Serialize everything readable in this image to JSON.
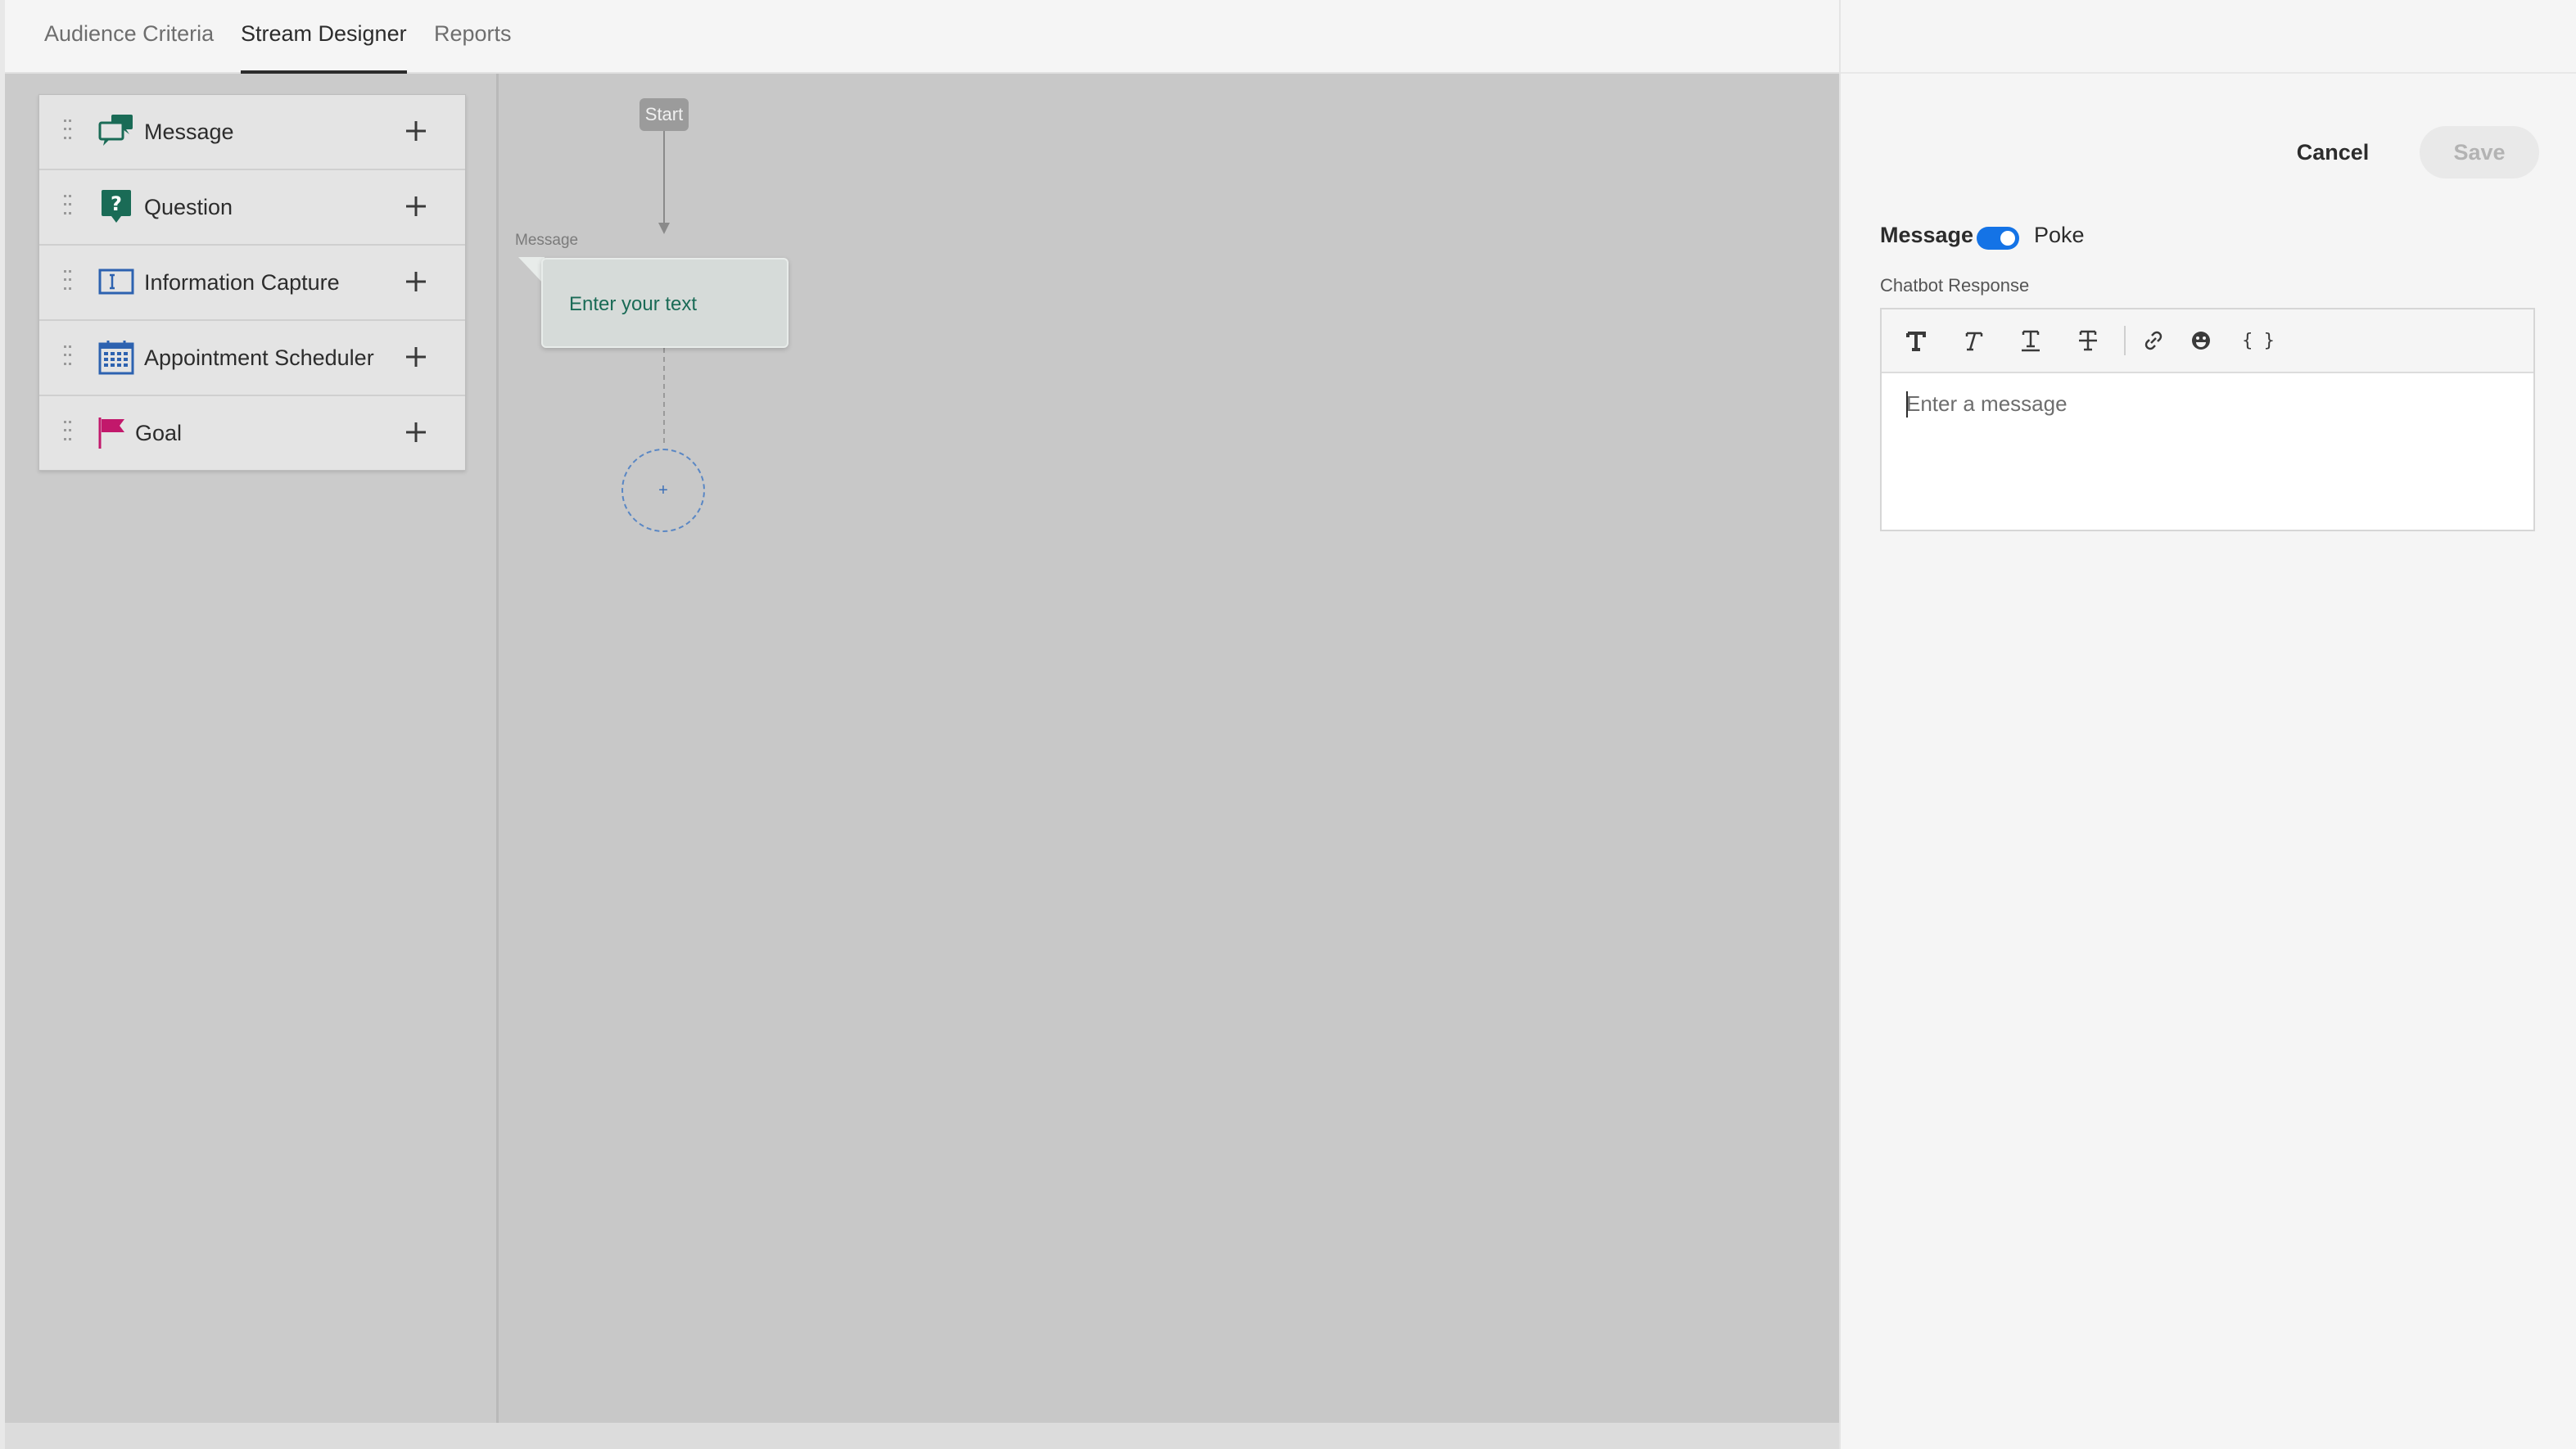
{
  "tabs": [
    {
      "label": "Audience Criteria",
      "active": false
    },
    {
      "label": "Stream Designer",
      "active": true
    },
    {
      "label": "Reports",
      "active": false
    }
  ],
  "palette": {
    "items": [
      {
        "label": "Message",
        "icon": "message-icon",
        "color": "#1a6b56"
      },
      {
        "label": "Question",
        "icon": "question-icon",
        "color": "#1a6b56"
      },
      {
        "label": "Information Capture",
        "icon": "information-capture-icon",
        "color": "#2d62b0"
      },
      {
        "label": "Appointment Scheduler",
        "icon": "calendar-icon",
        "color": "#2d62b0"
      },
      {
        "label": "Goal",
        "icon": "flag-icon",
        "color": "#c2186b"
      }
    ]
  },
  "canvas": {
    "start_label": "Start",
    "node_caption": "Message",
    "node_text": "Enter your text",
    "add_node_label": "+"
  },
  "panel": {
    "cancel_label": "Cancel",
    "save_label": "Save",
    "message_label": "Message",
    "poke_label": "Poke",
    "toggle_on": true,
    "chatbot_response_label": "Chatbot Response",
    "editor_placeholder": "Enter a message",
    "toolbar": [
      "bold-icon",
      "italic-icon",
      "underline-icon",
      "strikethrough-icon",
      "link-icon",
      "emoji-icon",
      "variable-braces-icon"
    ],
    "variable_button_label": "{ }"
  },
  "colors": {
    "accent": "#1473e6",
    "message_green": "#1a6b56",
    "goal_pink": "#c2186b"
  }
}
